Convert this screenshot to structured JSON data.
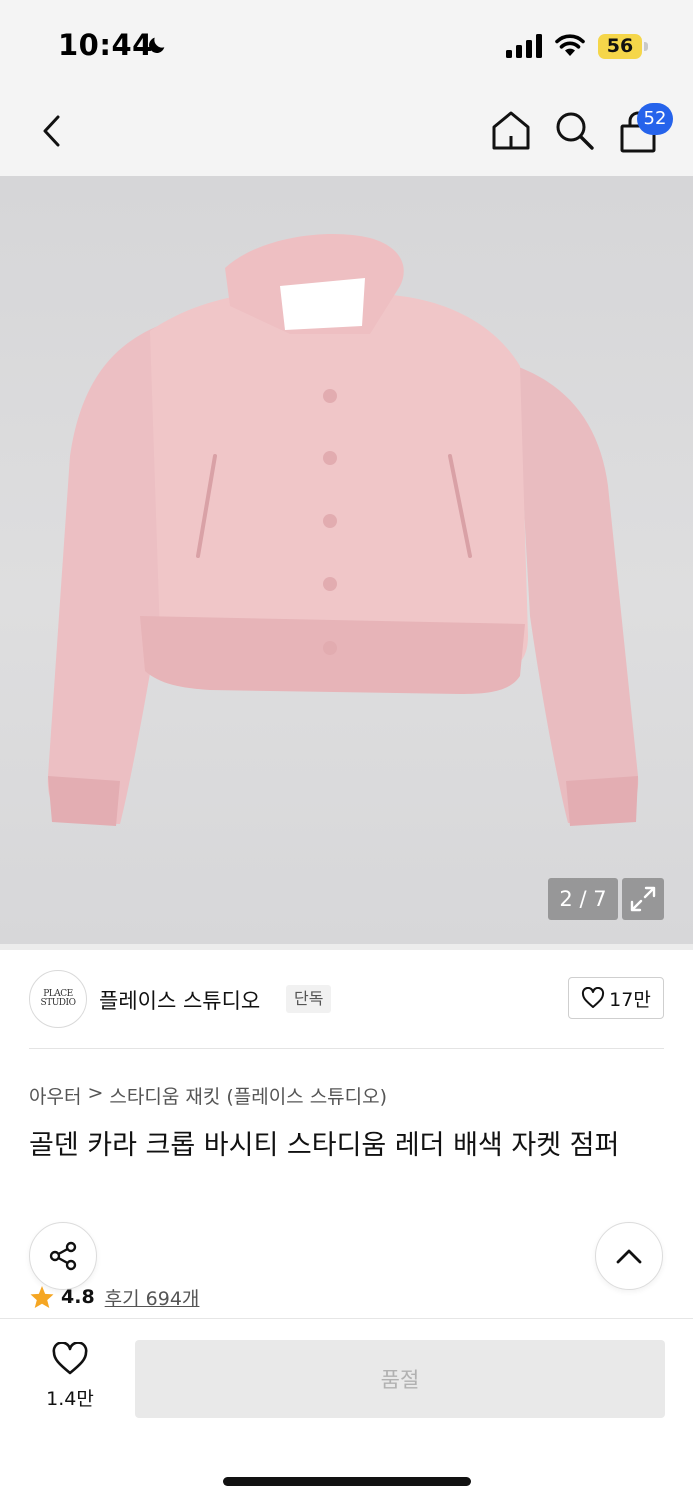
{
  "status_bar": {
    "time": "10:44",
    "battery": "56",
    "icons": [
      "moon-icon",
      "signal-icon",
      "wifi-icon",
      "battery-icon"
    ]
  },
  "nav": {
    "icons": [
      "back-icon",
      "home-icon",
      "search-icon",
      "cart-icon"
    ],
    "cart_badge": "52",
    "badge_color": "#2563eb"
  },
  "gallery": {
    "counter": "2 / 7",
    "expand_icon": "expand-icon",
    "image_description_color": "#f0c6c8"
  },
  "brand": {
    "logo_text": "PLACE STUDIO",
    "name": "플레이스 스튜디오",
    "tag": "단독",
    "like_count": "17만"
  },
  "product": {
    "breadcrumb": [
      "아우터",
      ">",
      "스타디움 재킷 (플레이스 스튜디오)"
    ],
    "title": "골덴 카라 크롭 바시티 스타디움 레더 배색 자켓 점퍼",
    "rating": "4.8",
    "reviews": "후기 694개",
    "star_color": "#f5a623"
  },
  "bottom_bar": {
    "wish_count": "1.4만",
    "soldout_label": "품절"
  }
}
